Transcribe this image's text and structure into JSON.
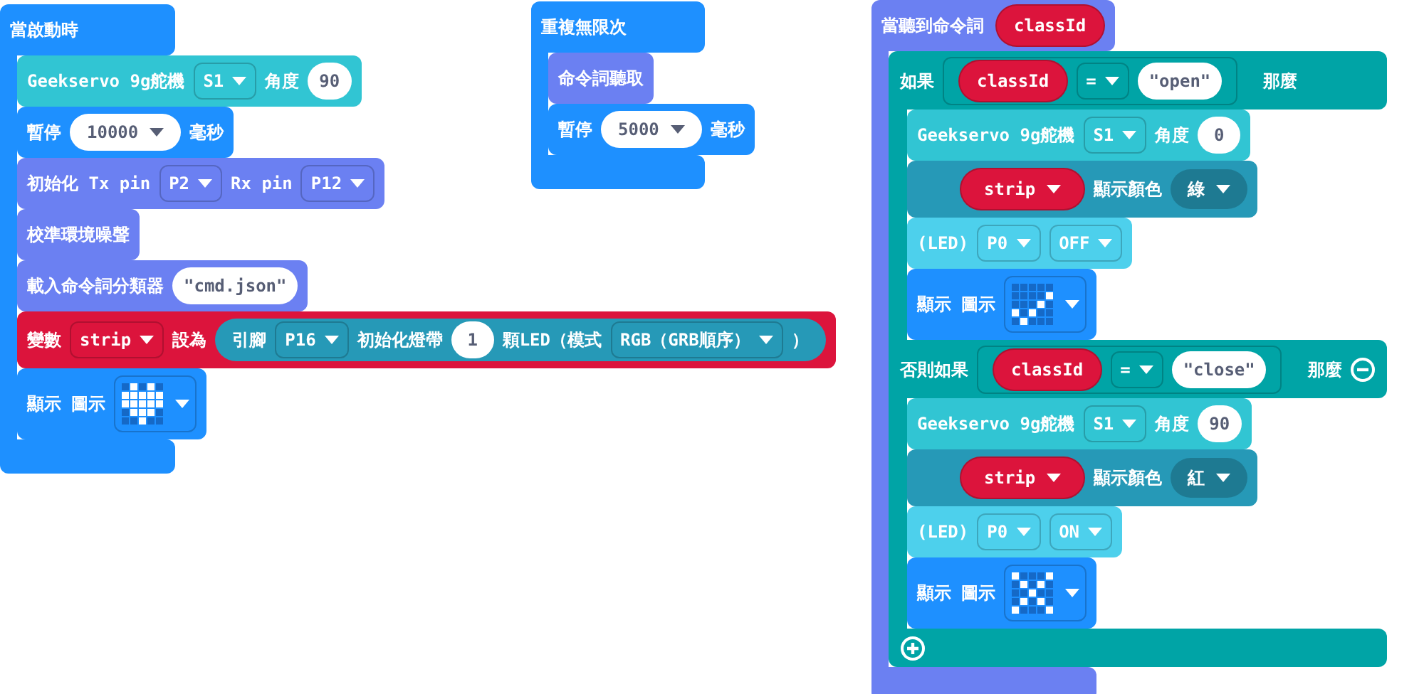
{
  "stacks": [
    {
      "kind": "event",
      "parts": [
        {
          "kind": "label",
          "text": "當啟動時"
        }
      ],
      "body": [
        {
          "kind": "servo",
          "parts": [
            {
              "kind": "label",
              "text": "Geekservo 9g舵機"
            },
            {
              "kind": "dropdown",
              "text": "S1"
            },
            {
              "kind": "label",
              "text": "角度"
            },
            {
              "kind": "number",
              "text": "90"
            }
          ]
        },
        {
          "kind": "basic",
          "parts": [
            {
              "kind": "label",
              "text": "暫停"
            },
            {
              "kind": "number_dropdown",
              "text": "10000"
            },
            {
              "kind": "label",
              "text": "毫秒"
            }
          ]
        },
        {
          "kind": "voice",
          "parts": [
            {
              "kind": "label",
              "text": "初始化 Tx pin"
            },
            {
              "kind": "dropdown",
              "text": "P2"
            },
            {
              "kind": "label",
              "text": "Rx pin"
            },
            {
              "kind": "dropdown",
              "text": "P12"
            }
          ]
        },
        {
          "kind": "voice",
          "parts": [
            {
              "kind": "label",
              "text": "校準環境噪聲"
            }
          ]
        },
        {
          "kind": "voice",
          "parts": [
            {
              "kind": "label",
              "text": "載入命令詞分類器"
            },
            {
              "kind": "string",
              "text": "\"cmd.json\""
            }
          ]
        },
        {
          "kind": "variables",
          "parts": [
            {
              "kind": "label",
              "text": "變數"
            },
            {
              "kind": "dropdown",
              "text": "strip"
            },
            {
              "kind": "label",
              "text": "設為"
            },
            {
              "kind": "reporter",
              "parts": [
                {
                  "kind": "label",
                  "text": "引腳"
                },
                {
                  "kind": "dropdown",
                  "text": "P16"
                },
                {
                  "kind": "label",
                  "text": "初始化燈帶"
                },
                {
                  "kind": "number",
                  "text": "1"
                },
                {
                  "kind": "label",
                  "text": "顆LED（模式"
                },
                {
                  "kind": "dropdown",
                  "text": "RGB（GRB順序）"
                },
                {
                  "kind": "label",
                  "text": "）"
                }
              ]
            }
          ]
        },
        {
          "kind": "basic",
          "parts": [
            {
              "kind": "label",
              "text": "顯示 圖示"
            },
            {
              "kind": "heart"
            }
          ]
        }
      ]
    },
    {
      "kind": "loop",
      "parts": [
        {
          "kind": "label",
          "text": "重複無限次"
        }
      ],
      "body": [
        {
          "kind": "voice",
          "parts": [
            {
              "kind": "label",
              "text": "命令詞聽取"
            }
          ]
        },
        {
          "kind": "basic",
          "parts": [
            {
              "kind": "label",
              "text": "暫停"
            },
            {
              "kind": "number_dropdown",
              "text": "5000"
            },
            {
              "kind": "label",
              "text": "毫秒"
            }
          ]
        }
      ]
    },
    {
      "kind": "voice",
      "parts": [
        {
          "kind": "label",
          "text": "當聽到命令詞"
        },
        {
          "kind": "variable",
          "text": "classId"
        }
      ],
      "body": [
        {
          "kind": "if",
          "add_button": true,
          "branches": [
            {
              "keyword": "如果",
              "then": "那麼",
              "removable": false,
              "condition": [
                {
                  "kind": "variable",
                  "text": "classId"
                },
                {
                  "kind": "dropdown",
                  "text": "="
                },
                {
                  "kind": "string",
                  "text": "\"open\""
                }
              ],
              "body": [
                {
                  "kind": "servo",
                  "parts": [
                    {
                      "kind": "label",
                      "text": "Geekservo 9g舵機"
                    },
                    {
                      "kind": "dropdown",
                      "text": "S1"
                    },
                    {
                      "kind": "label",
                      "text": "角度"
                    },
                    {
                      "kind": "number",
                      "text": "0"
                    }
                  ]
                },
                {
                  "kind": "neopixel",
                  "parts": [
                    {
                      "kind": "var_dropdown",
                      "text": "strip"
                    },
                    {
                      "kind": "label",
                      "text": "顯示顏色"
                    },
                    {
                      "kind": "pill_dropdown",
                      "text": "綠"
                    }
                  ]
                },
                {
                  "kind": "led",
                  "parts": [
                    {
                      "kind": "label",
                      "text": "(LED)"
                    },
                    {
                      "kind": "dropdown",
                      "text": "P0"
                    },
                    {
                      "kind": "dropdown",
                      "text": "OFF"
                    }
                  ]
                },
                {
                  "kind": "basic",
                  "parts": [
                    {
                      "kind": "label",
                      "text": "顯示 圖示"
                    },
                    {
                      "kind": "check"
                    }
                  ]
                }
              ]
            },
            {
              "keyword": "否則如果",
              "then": "那麼",
              "removable": true,
              "condition": [
                {
                  "kind": "variable",
                  "text": "classId"
                },
                {
                  "kind": "dropdown",
                  "text": "="
                },
                {
                  "kind": "string",
                  "text": "\"close\""
                }
              ],
              "body": [
                {
                  "kind": "servo",
                  "parts": [
                    {
                      "kind": "label",
                      "text": "Geekservo 9g舵機"
                    },
                    {
                      "kind": "dropdown",
                      "text": "S1"
                    },
                    {
                      "kind": "label",
                      "text": "角度"
                    },
                    {
                      "kind": "number",
                      "text": "90"
                    }
                  ]
                },
                {
                  "kind": "neopixel",
                  "parts": [
                    {
                      "kind": "var_dropdown",
                      "text": "strip"
                    },
                    {
                      "kind": "label",
                      "text": "顯示顏色"
                    },
                    {
                      "kind": "pill_dropdown",
                      "text": "紅"
                    }
                  ]
                },
                {
                  "kind": "led",
                  "parts": [
                    {
                      "kind": "label",
                      "text": "(LED)"
                    },
                    {
                      "kind": "dropdown",
                      "text": "P0"
                    },
                    {
                      "kind": "dropdown",
                      "text": "ON"
                    }
                  ]
                },
                {
                  "kind": "basic",
                  "parts": [
                    {
                      "kind": "label",
                      "text": "顯示 圖示"
                    },
                    {
                      "kind": "cross"
                    }
                  ]
                }
              ]
            }
          ]
        }
      ]
    }
  ]
}
